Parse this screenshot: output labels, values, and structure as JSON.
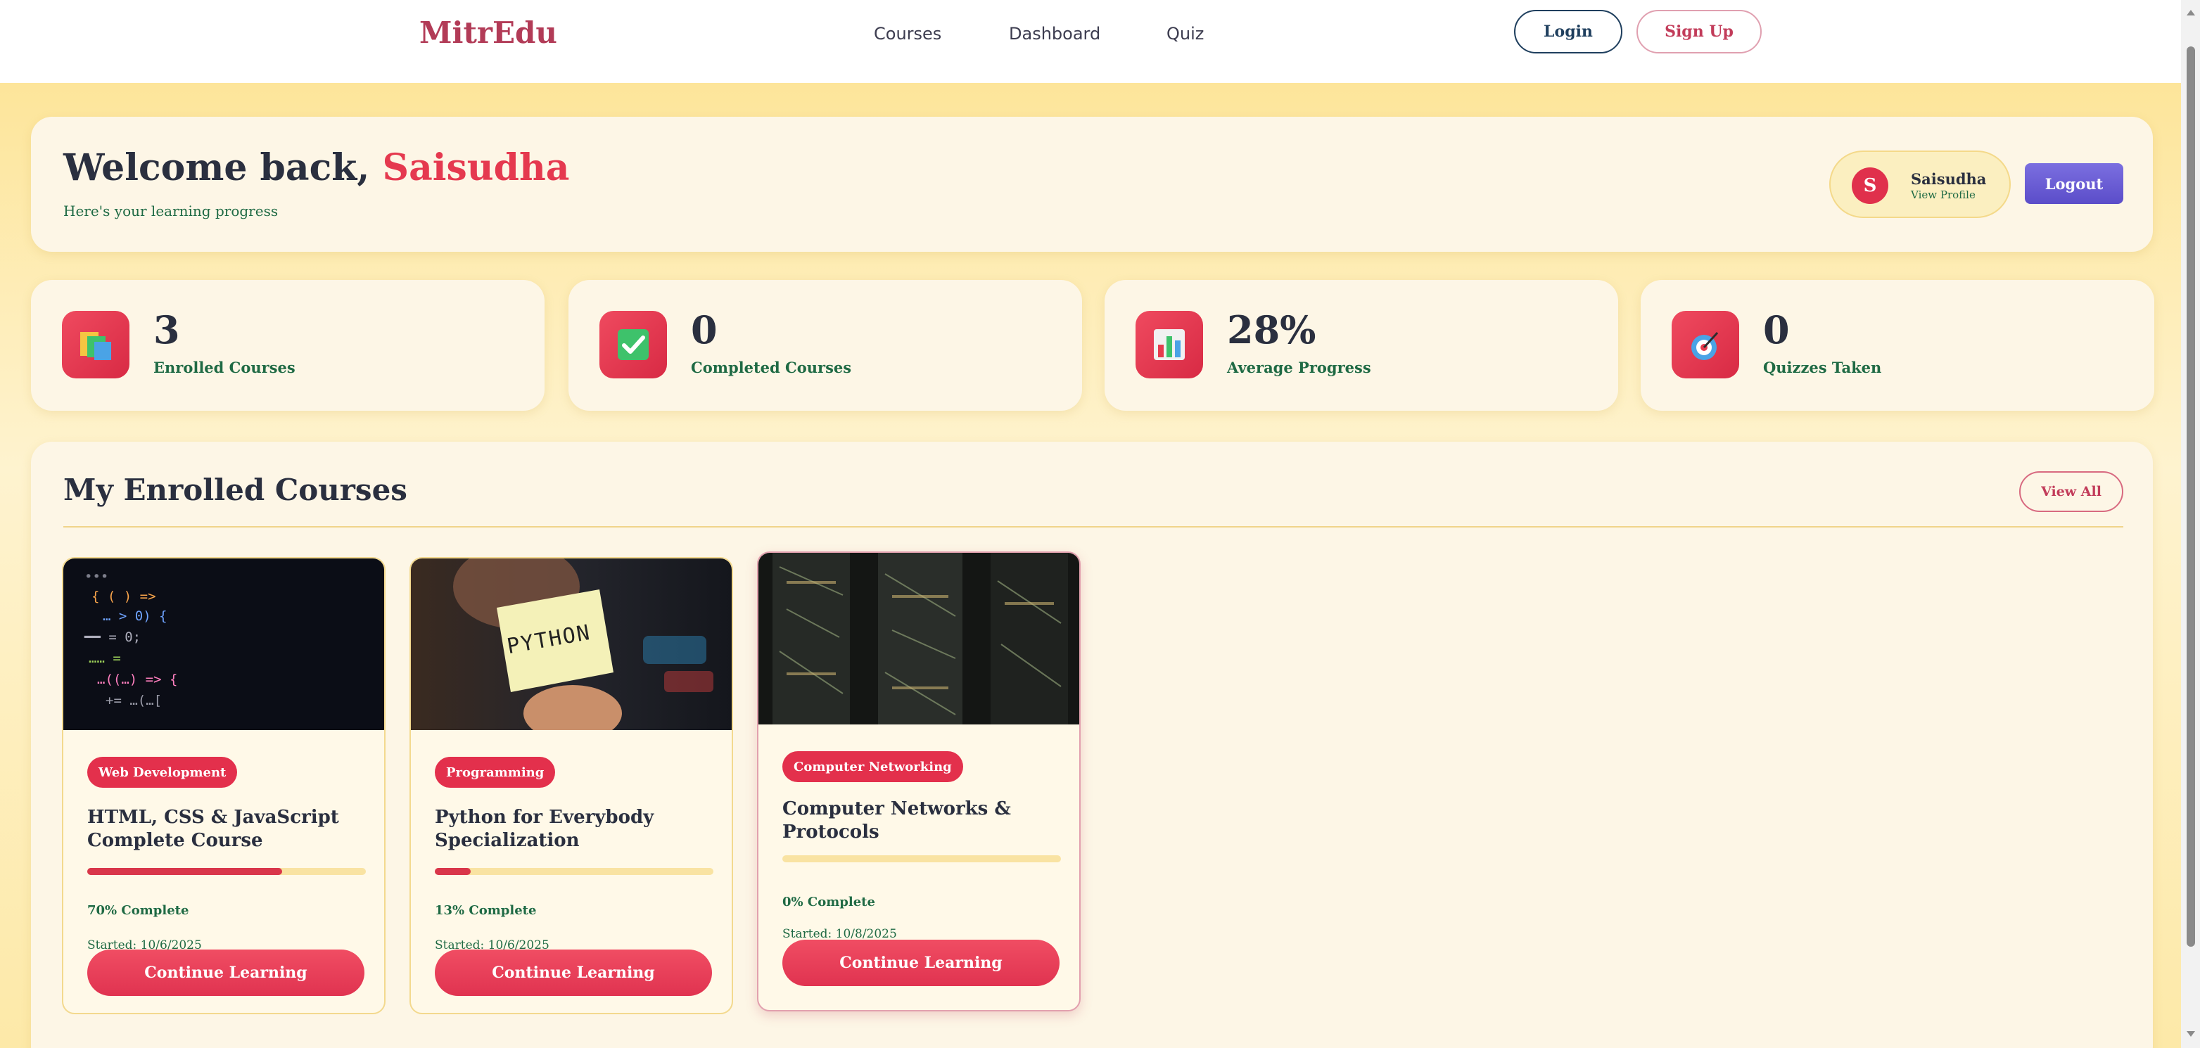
{
  "nav": {
    "brand": "MitrEdu",
    "links": [
      "Courses",
      "Dashboard",
      "Quiz"
    ],
    "login": "Login",
    "signup": "Sign Up"
  },
  "welcome": {
    "greeting": "Welcome back, ",
    "name": "Saisudha",
    "subtitle": "Here's your learning progress",
    "profile": {
      "initial": "S",
      "name": "Saisudha",
      "link": "View Profile"
    },
    "logout": "Logout"
  },
  "stats": [
    {
      "icon": "book-stack-icon",
      "value": "3",
      "label": "Enrolled Courses"
    },
    {
      "icon": "checkmark-icon",
      "value": "0",
      "label": "Completed Courses"
    },
    {
      "icon": "bar-chart-icon",
      "value": "28%",
      "label": "Average Progress"
    },
    {
      "icon": "target-icon",
      "value": "0",
      "label": "Quizzes Taken"
    }
  ],
  "enrolled": {
    "title": "My Enrolled Courses",
    "view_all": "View All",
    "courses": [
      {
        "tag": "Web Development",
        "title": "HTML, CSS & JavaScript Complete Course",
        "progress": 70,
        "progress_text": "70% Complete",
        "started": "Started: 10/6/2025",
        "button": "Continue Learning"
      },
      {
        "tag": "Programming",
        "title": "Python for Everybody Specialization",
        "progress": 13,
        "progress_text": "13% Complete",
        "started": "Started: 10/6/2025",
        "button": "Continue Learning",
        "thumb_text": "PYTHON"
      },
      {
        "tag": "Computer Networking",
        "title": "Computer Networks & Protocols",
        "progress": 0,
        "progress_text": "0% Complete",
        "started": "Started: 10/8/2025",
        "button": "Continue Learning"
      }
    ]
  },
  "colors": {
    "accent": "#e5394f",
    "brand": "#b23b57",
    "green": "#1f6a44",
    "logout": "#5b4dc9"
  }
}
